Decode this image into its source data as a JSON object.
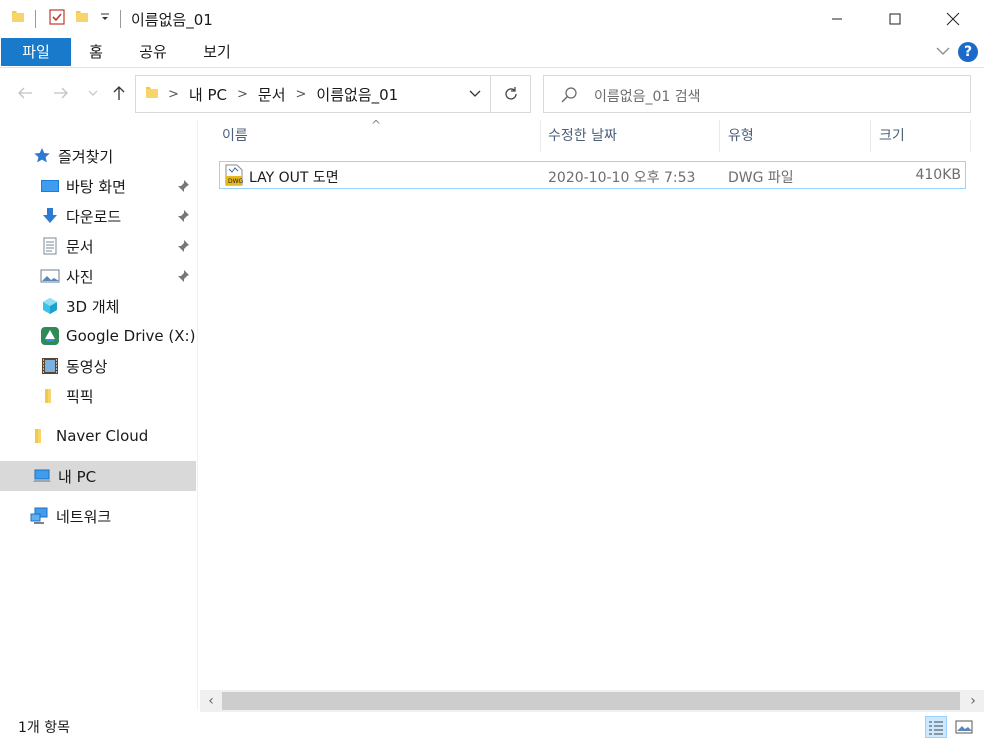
{
  "window": {
    "title": "이름없음_01"
  },
  "ribbon": {
    "tabs": [
      "파일",
      "홈",
      "공유",
      "보기"
    ]
  },
  "address": {
    "crumbs": [
      "내 PC",
      "문서",
      "이름없음_01"
    ]
  },
  "search": {
    "placeholder": "이름없음_01 검색"
  },
  "sidebar": {
    "quick_access": "즐겨찾기",
    "items": [
      {
        "label": "바탕 화면",
        "pinned": true
      },
      {
        "label": "다운로드",
        "pinned": true
      },
      {
        "label": "문서",
        "pinned": true
      },
      {
        "label": "사진",
        "pinned": true
      },
      {
        "label": "3D 개체",
        "pinned": false
      },
      {
        "label": "Google Drive (X:)",
        "pinned": false
      },
      {
        "label": "동영상",
        "pinned": false
      },
      {
        "label": "픽픽",
        "pinned": false
      }
    ],
    "naver": "Naver Cloud",
    "this_pc": "내 PC",
    "network": "네트워크"
  },
  "columns": {
    "name": "이름",
    "date": "수정한 날짜",
    "type": "유형",
    "size": "크기"
  },
  "files": [
    {
      "name": "LAY OUT 도면",
      "date": "2020-10-10 오후 7:53",
      "type": "DWG 파일",
      "size": "410KB"
    }
  ],
  "status": {
    "count": "1개 항목"
  },
  "colors": {
    "accent": "#1979ca",
    "selection_border": "#99d1ff"
  }
}
